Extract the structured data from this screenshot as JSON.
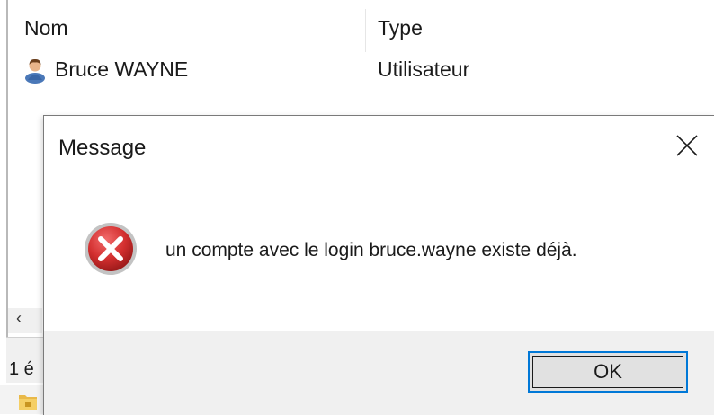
{
  "list": {
    "columns": {
      "name": "Nom",
      "type": "Type"
    },
    "rows": [
      {
        "name": "Bruce WAYNE",
        "type": "Utilisateur",
        "icon": "user-icon"
      }
    ],
    "scroll_left_glyph": "‹",
    "status_text": "1 é"
  },
  "dialog": {
    "title": "Message",
    "close_glyph": "✕",
    "icon": "error-icon",
    "message": "un compte avec le login bruce.wayne existe déjà.",
    "ok_label": "OK"
  },
  "colors": {
    "accent": "#0078d7",
    "error": "#d32f2f",
    "footer": "#f0f0f0"
  }
}
